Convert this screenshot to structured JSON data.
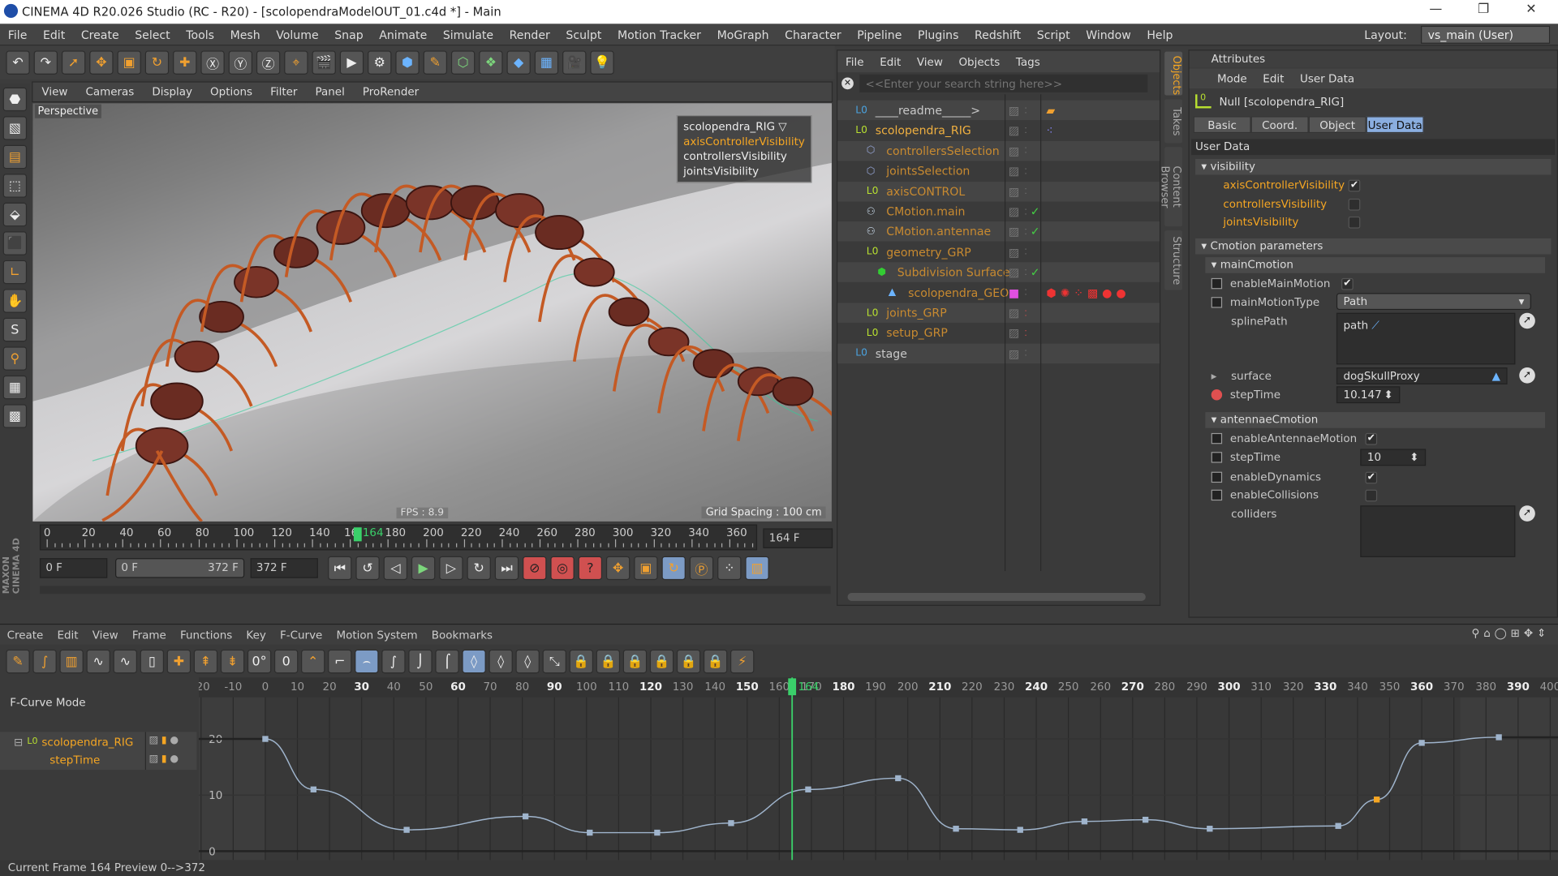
{
  "window": {
    "title": "CINEMA 4D R20.026 Studio (RC - R20) - [scolopendraModelOUT_01.c4d *] - Main",
    "controls": [
      "—",
      "❐",
      "✕"
    ]
  },
  "menu": [
    "File",
    "Edit",
    "Create",
    "Select",
    "Tools",
    "Mesh",
    "Volume",
    "Snap",
    "Animate",
    "Simulate",
    "Render",
    "Sculpt",
    "Motion Tracker",
    "MoGraph",
    "Character",
    "Pipeline",
    "Plugins",
    "Redshift",
    "Script",
    "Window",
    "Help"
  ],
  "layout": {
    "label": "Layout:",
    "value": "vs_main (User)"
  },
  "viewport": {
    "menu": [
      "View",
      "Cameras",
      "Display",
      "Options",
      "Filter",
      "Panel",
      "ProRender"
    ],
    "camera": "Perspective",
    "hud": {
      "object": "scolopendra_RIG ▽",
      "items": [
        "axisControllerVisibility",
        "controllersVisibility",
        "jointsVisibility"
      ]
    },
    "fps": "FPS : 8.9",
    "grid_spacing": "Grid Spacing : 100 cm"
  },
  "timeline": {
    "ticks": [
      0,
      20,
      40,
      60,
      80,
      100,
      120,
      140,
      160,
      180,
      200,
      220,
      240,
      260,
      280,
      300,
      320,
      340,
      360
    ],
    "current_frame": 164,
    "current_label": "164",
    "frame_field": "164 F",
    "start": "0 F",
    "range_start": "0 F",
    "range_end": "372 F",
    "end": "372 F"
  },
  "objects": {
    "menu": [
      "File",
      "Edit",
      "View",
      "Objects",
      "Tags"
    ],
    "search_placeholder": "<<Enter your search string here>>",
    "items": [
      {
        "name": "____readme_____>",
        "color": "#c8c8c8",
        "depth": 0,
        "icon": "null-icon"
      },
      {
        "name": "scolopendra_RIG",
        "color": "#f0b040",
        "depth": 0,
        "icon": "null-icon"
      },
      {
        "name": "controllersSelection",
        "color": "#c88a30",
        "depth": 1,
        "icon": "selection-icon"
      },
      {
        "name": "jointsSelection",
        "color": "#c88a30",
        "depth": 1,
        "icon": "selection-icon"
      },
      {
        "name": "axisCONTROL",
        "color": "#c88a30",
        "depth": 1,
        "icon": "null-icon"
      },
      {
        "name": "CMotion.main",
        "color": "#c88a30",
        "depth": 1,
        "icon": "cmotion-icon",
        "check": true
      },
      {
        "name": "CMotion.antennae",
        "color": "#c88a30",
        "depth": 1,
        "icon": "cmotion-icon",
        "check": true
      },
      {
        "name": "geometry_GRP",
        "color": "#c88a30",
        "depth": 1,
        "icon": "null-icon"
      },
      {
        "name": "Subdivision Surface",
        "color": "#c88a30",
        "depth": 2,
        "icon": "subdivision-icon",
        "check": true
      },
      {
        "name": "scolopendra_GEO",
        "color": "#c88a30",
        "depth": 3,
        "icon": "polygon-icon"
      },
      {
        "name": "joints_GRP",
        "color": "#c88a30",
        "depth": 1,
        "icon": "null-icon"
      },
      {
        "name": "setup_GRP",
        "color": "#c88a30",
        "depth": 1,
        "icon": "null-icon"
      },
      {
        "name": "stage",
        "color": "#c8c8c8",
        "depth": 0,
        "icon": "null-icon"
      }
    ],
    "side_tabs": [
      "Objects",
      "Takes",
      "Content Browser",
      "Structure"
    ]
  },
  "attributes": {
    "title": "Attributes",
    "menu": [
      "Mode",
      "Edit",
      "User Data"
    ],
    "object": "Null [scolopendra_RIG]",
    "tabs": [
      "Basic",
      "Coord.",
      "Object",
      "User Data"
    ],
    "active_tab": "User Data",
    "section": "User Data",
    "visibility": {
      "title": "visibility",
      "axisControllerVisibility": "axisControllerVisibility",
      "axis_checked": true,
      "controllersVisibility": "controllersVisibility",
      "jointsVisibility": "jointsVisibility"
    },
    "cmotion": {
      "title": "Cmotion parameters",
      "main": {
        "title": "mainCmotion",
        "enableMainMotion": "enableMainMotion",
        "mainMotionType": "mainMotionType",
        "mainMotionType_value": "Path",
        "splinePath": "splinePath",
        "splinePath_value": "path",
        "surface": "surface",
        "surface_value": "dogSkullProxy",
        "stepTime": "stepTime",
        "stepTime_value": "10.147"
      },
      "antennae": {
        "title": "antennaeCmotion",
        "enableAntennaeMotion": "enableAntennaeMotion",
        "stepTime": "stepTime",
        "stepTime_value": "10",
        "enableDynamics": "enableDynamics",
        "enableCollisions": "enableCollisions",
        "colliders": "colliders"
      }
    }
  },
  "timeline_panel": {
    "menu": [
      "Create",
      "Edit",
      "View",
      "Frame",
      "Functions",
      "Key",
      "F-Curve",
      "Motion System",
      "Bookmarks"
    ],
    "mode": "F-Curve Mode",
    "tracks": [
      {
        "name": "scolopendra_RIG"
      },
      {
        "name": "stepTime"
      }
    ],
    "status": "Current Frame  164  Preview  0-->372"
  },
  "chart_data": {
    "type": "line",
    "title": "stepTime F-Curve",
    "x": [
      0,
      15,
      44,
      81,
      101,
      122,
      145,
      169,
      197,
      215,
      235,
      255,
      274,
      294,
      334,
      346,
      360,
      384
    ],
    "values": [
      20,
      11,
      3.8,
      6.2,
      3.3,
      3.3,
      5,
      11,
      13,
      4,
      3.8,
      5.3,
      5.6,
      4,
      4.5,
      9.2,
      19.3,
      20.3
    ],
    "selected_key_index": 15,
    "xlim": [
      -20,
      400
    ],
    "ylim": [
      0,
      22
    ],
    "xticks": [
      -20,
      -10,
      0,
      10,
      20,
      30,
      40,
      50,
      60,
      70,
      80,
      90,
      100,
      110,
      120,
      130,
      140,
      150,
      160,
      170,
      180,
      190,
      200,
      210,
      220,
      230,
      240,
      250,
      260,
      270,
      280,
      290,
      300,
      310,
      320,
      330,
      340,
      350,
      360,
      370,
      380,
      390,
      400
    ],
    "yticks": [
      0,
      10,
      20
    ],
    "current_frame": 164,
    "colors": {
      "curve": "#9fb4cc",
      "key": "#9fb4cc",
      "selected": "#f5a623",
      "playhead": "#3ad06a"
    }
  }
}
